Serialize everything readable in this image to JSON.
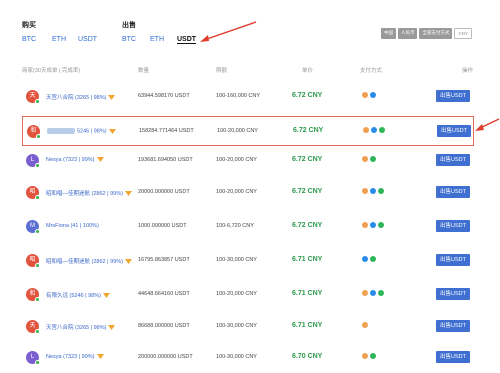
{
  "buy": {
    "title": "购买",
    "currencies": [
      "BTC",
      "ETH",
      "USDT"
    ]
  },
  "sell": {
    "title": "出售",
    "currencies": [
      "BTC",
      "ETH",
      "USDT"
    ],
    "active": "USDT"
  },
  "filters": {
    "chips": [
      "中国",
      "人民币",
      "全部支付方式"
    ],
    "box_label": "CNY"
  },
  "table": {
    "headers": [
      "商家(30天成单 | 完成率)",
      "数量",
      "限额",
      "单价",
      "支付方式",
      "操作"
    ]
  },
  "rows": [
    {
      "avatar": "天",
      "avatar_color": "#e2533e",
      "name": "天宫八合院 (3265 | 98%)",
      "badge": true,
      "quantity": "63944.598170 USDT",
      "limit": "100-160,000 CNY",
      "price": "6.72 CNY",
      "pay": [
        "p1",
        "p2"
      ],
      "button": "出售USDT"
    },
    {
      "avatar": "和",
      "avatar_color": "#e2533e",
      "name": "5246 | 98%)",
      "blurred": true,
      "badge": true,
      "quantity": "158284.771464 USDT",
      "limit": "100-20,000 CNY",
      "price": "6.72 CNY",
      "pay": [
        "p1",
        "p2",
        "p3"
      ],
      "button": "出售USDT"
    },
    {
      "avatar": "L",
      "avatar_color": "#7a5fd1",
      "name": "Nesya (7323 | 99%)",
      "badge": true,
      "quantity": "193681.694050 USDT",
      "limit": "100-20,000 CNY",
      "price": "6.72 CNY",
      "pay": [
        "p1",
        "p3"
      ],
      "button": "出售USDT"
    },
    {
      "avatar": "昭",
      "avatar_color": "#e2533e",
      "name": "昭和唱—佳期迷航 (2862 | 99%)",
      "badge": true,
      "quantity": "20000.000000 USDT",
      "limit": "100-20,000 CNY",
      "price": "6.72 CNY",
      "pay": [
        "p1",
        "p2",
        "p3"
      ],
      "button": "出售USDT"
    },
    {
      "avatar": "M",
      "avatar_color": "#5a6fd1",
      "name": "MrsFiona (41 | 100%)",
      "badge": false,
      "quantity": "1000.000000 USDT",
      "limit": "100-6,720 CNY",
      "price": "6.72 CNY",
      "pay": [
        "p1",
        "p2",
        "p3"
      ],
      "button": "出售USDT"
    },
    {
      "avatar": "昭",
      "avatar_color": "#e2533e",
      "name": "昭和唱—佳期迷航 (2862 | 99%)",
      "badge": true,
      "quantity": "16795.863857 USDT",
      "limit": "100-30,000 CNY",
      "price": "6.71 CNY",
      "pay": [
        "p2",
        "p3"
      ],
      "button": "出售USDT"
    },
    {
      "avatar": "和",
      "avatar_color": "#e2533e",
      "name": "有限久远 (5246 | 98%)",
      "badge": true,
      "quantity": "44648.664160 USDT",
      "limit": "100-20,000 CNY",
      "price": "6.71 CNY",
      "pay": [
        "p1",
        "p2",
        "p3"
      ],
      "button": "出售USDT"
    },
    {
      "avatar": "天",
      "avatar_color": "#e2533e",
      "name": "天宫八合院 (3265 | 98%)",
      "badge": true,
      "quantity": "86688.000000 USDT",
      "limit": "100-30,000 CNY",
      "price": "6.71 CNY",
      "pay": [
        "p1"
      ],
      "button": "出售USDT"
    },
    {
      "avatar": "L",
      "avatar_color": "#7a5fd1",
      "name": "Nesya (7323 | 99%)",
      "badge": true,
      "quantity": "200000.000000 USDT",
      "limit": "100-30,000 CNY",
      "price": "6.70 CNY",
      "pay": [
        "p1",
        "p3"
      ],
      "button": "出售USDT"
    }
  ],
  "colors": {
    "accent": "#3f6fd1",
    "price": "#2c9b4d",
    "highlight": "#e06b5a"
  }
}
